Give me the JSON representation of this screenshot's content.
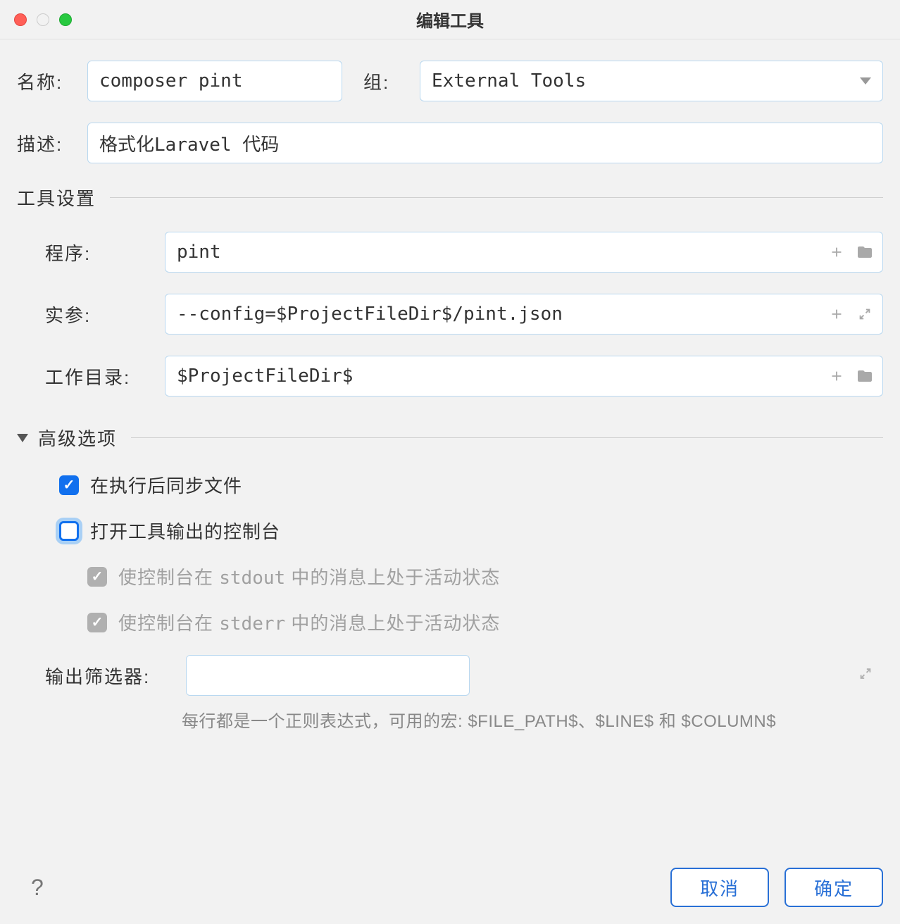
{
  "window": {
    "title": "编辑工具"
  },
  "fields": {
    "name_label": "名称:",
    "name_value": "composer pint",
    "group_label": "组:",
    "group_value": "External Tools",
    "desc_label": "描述:",
    "desc_value": "格式化Laravel 代码"
  },
  "tool_settings": {
    "title": "工具设置",
    "program_label": "程序:",
    "program_value": "pint",
    "args_label": "实参:",
    "args_value": "--config=$ProjectFileDir$/pint.json",
    "workdir_label": "工作目录:",
    "workdir_value": "$ProjectFileDir$"
  },
  "advanced": {
    "title": "高级选项",
    "sync_files": {
      "label": "在执行后同步文件",
      "checked": true
    },
    "open_console": {
      "label": "打开工具输出的控制台",
      "checked": false
    },
    "stdout_active": {
      "label_pre": "使控制台在 ",
      "code": "stdout",
      "label_post": " 中的消息上处于活动状态",
      "checked": true,
      "disabled": true
    },
    "stderr_active": {
      "label_pre": "使控制台在 ",
      "code": "stderr",
      "label_post": " 中的消息上处于活动状态",
      "checked": true,
      "disabled": true
    },
    "filter_label": "输出筛选器:",
    "filter_value": "",
    "filter_hint": "每行都是一个正则表达式，可用的宏: $FILE_PATH$、$LINE$ 和 $COLUMN$"
  },
  "footer": {
    "cancel": "取消",
    "ok": "确定"
  }
}
